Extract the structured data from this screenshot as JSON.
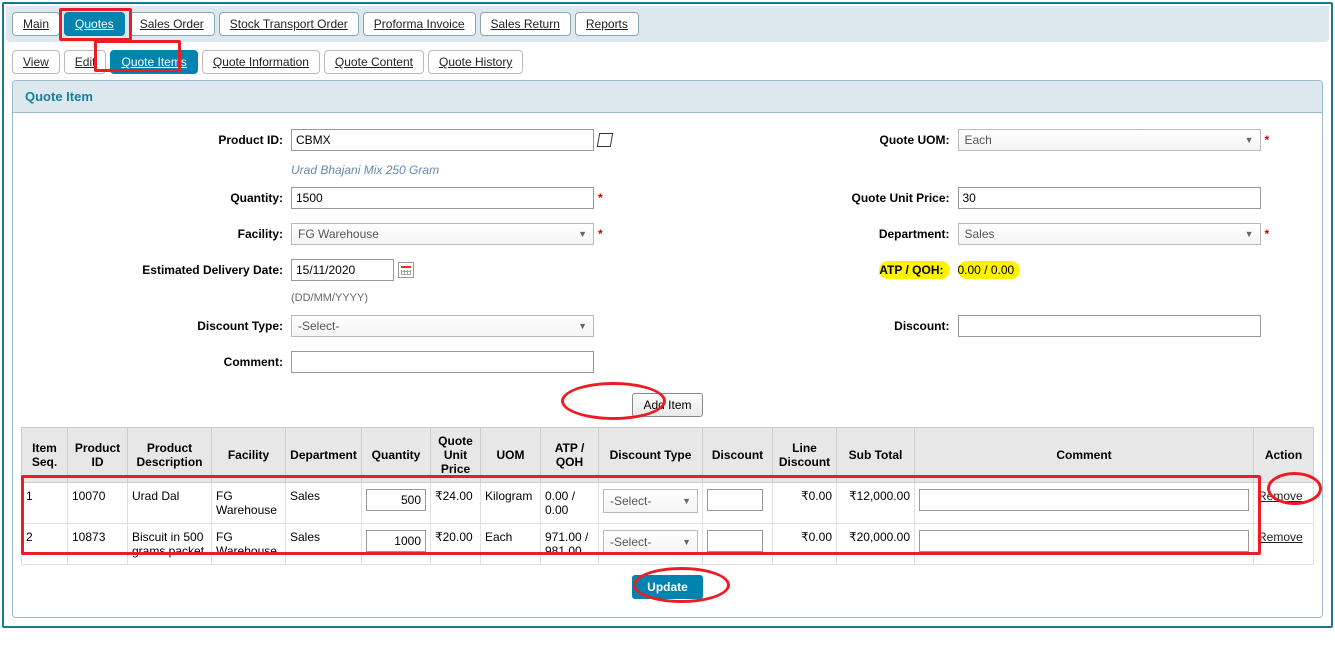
{
  "top_tabs": {
    "main": "Main",
    "quotes": "Quotes",
    "sales_order": "Sales Order",
    "stock_transport": "Stock Transport Order",
    "proforma": "Proforma Invoice",
    "sales_return": "Sales Return",
    "reports": "Reports"
  },
  "sub_tabs": {
    "view": "View",
    "edit": "Edit",
    "quote_items": "Quote Items",
    "quote_information": "Quote Information",
    "quote_content": "Quote Content",
    "quote_history": "Quote History"
  },
  "panel_header": "Quote Item",
  "form": {
    "product_id_label": "Product ID:",
    "product_id_value": "CBMX",
    "product_desc": "Urad Bhajani Mix 250 Gram",
    "quantity_label": "Quantity:",
    "quantity_value": "1500",
    "facility_label": "Facility:",
    "facility_value": "FG Warehouse",
    "date_label": "Estimated Delivery Date:",
    "date_value": "15/11/2020",
    "date_hint": "(DD/MM/YYYY)",
    "discount_type_label": "Discount Type:",
    "discount_type_value": "-Select-",
    "comment_label": "Comment:",
    "comment_value": "",
    "uom_label": "Quote UOM:",
    "uom_value": "Each",
    "unit_price_label": "Quote Unit Price:",
    "unit_price_value": "30",
    "department_label": "Department:",
    "department_value": "Sales",
    "atp_label": "ATP / QOH:",
    "atp_value": "0.00 / 0.00",
    "discount_label": "Discount:",
    "discount_value": ""
  },
  "buttons": {
    "add_item": "Add Item",
    "update": "Update",
    "remove": "Remove"
  },
  "table": {
    "headers": {
      "seq": "Item Seq.",
      "pid": "Product ID",
      "desc": "Product Description",
      "facility": "Facility",
      "dept": "Department",
      "qty": "Quantity",
      "price": "Quote Unit Price",
      "uom": "UOM",
      "atp": "ATP / QOH",
      "dtype": "Discount Type",
      "discount": "Discount",
      "ldisc": "Line Discount",
      "subtotal": "Sub Total",
      "comment": "Comment",
      "action": "Action"
    },
    "rows": [
      {
        "seq": "1",
        "pid": "10070",
        "desc": "Urad Dal",
        "facility": "FG Warehouse",
        "dept": "Sales",
        "qty": "500",
        "price": "₹24.00",
        "uom": "Kilogram",
        "atp": "0.00 / 0.00",
        "dtype": "-Select-",
        "discount": "",
        "ldisc": "₹0.00",
        "subtotal": "₹12,000.00",
        "comment": ""
      },
      {
        "seq": "2",
        "pid": "10873",
        "desc": "Biscuit in 500 grams packet",
        "facility": "FG Warehouse",
        "dept": "Sales",
        "qty": "1000",
        "price": "₹20.00",
        "uom": "Each",
        "atp": "971.00 / 981.00",
        "dtype": "-Select-",
        "discount": "",
        "ldisc": "₹0.00",
        "subtotal": "₹20,000.00",
        "comment": ""
      }
    ]
  }
}
